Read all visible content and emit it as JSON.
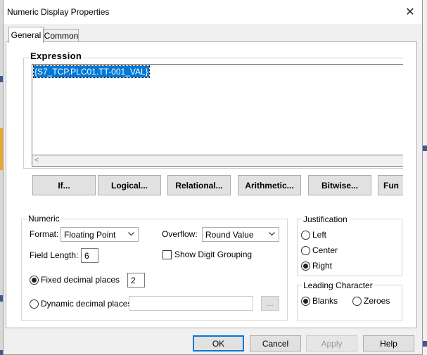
{
  "dialog": {
    "title": "Numeric Display Properties",
    "close_glyph": "✕"
  },
  "tabs": [
    {
      "label": "General",
      "active": true
    },
    {
      "label": "Common",
      "active": false
    }
  ],
  "expression": {
    "group_label": "Expression",
    "value": "{S7_TCP.PLC01.TT-001_VAL}",
    "scroll_left_glyph": "<"
  },
  "operator_buttons": [
    {
      "label": "If..."
    },
    {
      "label": "Logical..."
    },
    {
      "label": "Relational..."
    },
    {
      "label": "Arithmetic..."
    },
    {
      "label": "Bitwise..."
    },
    {
      "label": "Fun"
    }
  ],
  "numeric": {
    "group_label": "Numeric",
    "format_label": "Format:",
    "format_value": "Floating Point",
    "overflow_label": "Overflow:",
    "overflow_value": "Round Value",
    "field_length_label": "Field Length:",
    "field_length_value": "6",
    "show_digit_grouping_label": "Show Digit Grouping",
    "show_digit_grouping_checked": false,
    "fixed_decimal_label": "Fixed decimal places",
    "fixed_decimal_value": "2",
    "fixed_decimal_selected": true,
    "dynamic_decimal_label": "Dynamic decimal places",
    "dynamic_decimal_value": "",
    "browse_label": "..."
  },
  "justification": {
    "group_label": "Justification",
    "options": [
      {
        "label": "Left",
        "selected": false
      },
      {
        "label": "Center",
        "selected": false
      },
      {
        "label": "Right",
        "selected": true
      }
    ]
  },
  "leading_character": {
    "group_label": "Leading Character",
    "options": [
      {
        "label": "Blanks",
        "selected": true
      },
      {
        "label": "Zeroes",
        "selected": false
      }
    ]
  },
  "footer": {
    "ok_label": "OK",
    "cancel_label": "Cancel",
    "apply_label": "Apply",
    "help_label": "Help"
  },
  "colors": {
    "selection": "#0078d7",
    "dialog_bg": "#f0f0f0",
    "panel_bg": "#ffffff",
    "background_accent": "#e8a830"
  },
  "icons": {
    "dropdown": "chevron-down-icon",
    "close": "close-icon"
  }
}
